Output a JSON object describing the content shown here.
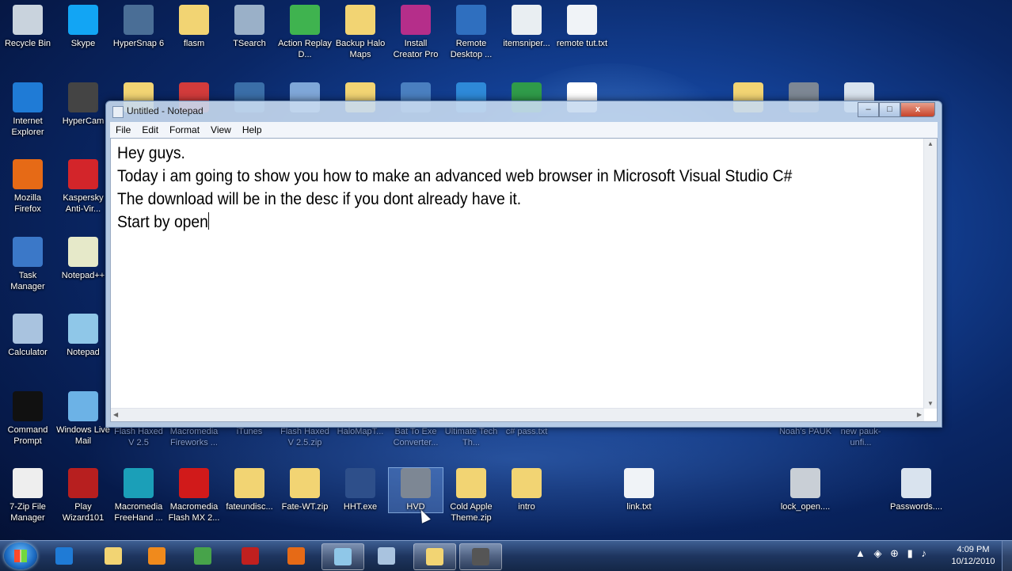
{
  "desktop": {
    "icons": [
      {
        "label": "Recycle Bin",
        "icon": "recycle-bin-icon",
        "color": "#c9d3dd"
      },
      {
        "label": "Skype",
        "icon": "skype-icon",
        "color": "#12a5f4"
      },
      {
        "label": "HyperSnap 6",
        "icon": "hypersnap-icon",
        "color": "#4a6e96"
      },
      {
        "label": "flasm",
        "icon": "folder-icon",
        "color": "#f2d473"
      },
      {
        "label": "TSearch",
        "icon": "tsearch-icon",
        "color": "#9ab0c8"
      },
      {
        "label": "Action Replay D...",
        "icon": "action-replay-icon",
        "color": "#3fb34f"
      },
      {
        "label": "Backup Halo Maps",
        "icon": "folder-icon",
        "color": "#f2d473"
      },
      {
        "label": "Install Creator Pro",
        "icon": "install-creator-icon",
        "color": "#b52e8a"
      },
      {
        "label": "Remote Desktop ...",
        "icon": "remote-desktop-icon",
        "color": "#2f6fbf"
      },
      {
        "label": "itemsniper...",
        "icon": "script-icon",
        "color": "#e9eef2"
      },
      {
        "label": "remote tut.txt",
        "icon": "text-file-icon",
        "color": "#f0f3f7"
      },
      {
        "label": "Internet Explorer",
        "icon": "ie-icon",
        "color": "#1f7bd6"
      },
      {
        "label": "HyperCam",
        "icon": "hypercam-icon",
        "color": "#444444"
      },
      {
        "label": "Mozilla Firefox",
        "icon": "firefox-icon",
        "color": "#e66a16"
      },
      {
        "label": "Kaspersky Anti-Vir...",
        "icon": "kaspersky-icon",
        "color": "#d3252a"
      },
      {
        "label": "Task Manager",
        "icon": "task-manager-icon",
        "color": "#3b78c8"
      },
      {
        "label": "Notepad++",
        "icon": "notepadpp-icon",
        "color": "#e6e9c9"
      },
      {
        "label": "Calculator",
        "icon": "calculator-icon",
        "color": "#a9c3df"
      },
      {
        "label": "Notepad",
        "icon": "notepad-icon",
        "color": "#8fc7e8"
      },
      {
        "label": "Command Prompt",
        "icon": "command-prompt-icon",
        "color": "#111111"
      },
      {
        "label": "Windows Live Mail",
        "icon": "mail-icon",
        "color": "#6cb2e6"
      },
      {
        "label": "7-Zip File Manager",
        "icon": "7zip-icon",
        "color": "#eeeeee"
      },
      {
        "label": "Play Wizard101",
        "icon": "wizard101-icon",
        "color": "#b71f1f"
      },
      {
        "label": "Macromedia FreeHand ...",
        "icon": "freehand-icon",
        "color": "#1b9fb8"
      },
      {
        "label": "Macromedia Flash MX 2...",
        "icon": "flash-icon",
        "color": "#d11a1a"
      },
      {
        "label": "fateundisc...",
        "icon": "zip-folder-icon",
        "color": "#f2d473"
      },
      {
        "label": "Fate-WT.zip",
        "icon": "zip-folder-icon",
        "color": "#f2d473"
      },
      {
        "label": "HHT.exe",
        "icon": "hht-icon",
        "color": "#2e4f8a"
      },
      {
        "label": "HVD",
        "icon": "gears-icon",
        "color": "#7d8794"
      },
      {
        "label": "Cold Apple Theme.zip",
        "icon": "zip-folder-icon",
        "color": "#f2d473"
      },
      {
        "label": "intro",
        "icon": "folder-icon",
        "color": "#f2d473"
      },
      {
        "label": "link.txt",
        "icon": "text-file-icon",
        "color": "#f0f3f7"
      },
      {
        "label": "lock_open....",
        "icon": "lock-icon",
        "color": "#c9cfd6"
      },
      {
        "label": "Passwords....",
        "icon": "settings-file-icon",
        "color": "#d9e3ee"
      }
    ],
    "hidden_labels": [
      "Flash Haxed V 2.5",
      "Macromedia Fireworks ...",
      "iTunes",
      "Flash Haxed V 2.5.zip",
      "HaloMapT...",
      "Bat To Exe Converter...",
      "Ultimate Tech Th...",
      "c# pass.txt",
      "Noah's PAUK",
      "new pauk-unfi..."
    ]
  },
  "notepad": {
    "title": "Untitled - Notepad",
    "menu": [
      "File",
      "Edit",
      "Format",
      "View",
      "Help"
    ],
    "controls": {
      "minimize": "–",
      "maximize": "□",
      "close": "x"
    },
    "text_lines": [
      "Hey guys.",
      "Today i am going to show you how to make an advanced web browser in Microsoft Visual Studio C#",
      "The download will be in the desc if you dont already have it.",
      "Start by open"
    ]
  },
  "taskbar": {
    "start_icon": "windows-start-icon",
    "items": [
      {
        "icon": "ie-icon",
        "color": "#1f7bd6",
        "active": false
      },
      {
        "icon": "explorer-icon",
        "color": "#f2d473",
        "active": false
      },
      {
        "icon": "media-player-icon",
        "color": "#f08a1c",
        "active": false
      },
      {
        "icon": "media-center-icon",
        "color": "#47a34a",
        "active": false
      },
      {
        "icon": "wizard101-icon",
        "color": "#c0201f",
        "active": false
      },
      {
        "icon": "firefox-icon",
        "color": "#e66a16",
        "active": false
      },
      {
        "icon": "notepad-icon",
        "color": "#8fc7e8",
        "active": true
      },
      {
        "icon": "calculator-icon",
        "color": "#a9c3df",
        "active": false
      },
      {
        "icon": "folder-icon",
        "color": "#f2d473",
        "active": true
      },
      {
        "icon": "hypercam-icon",
        "color": "#555555",
        "active": true
      }
    ],
    "tray_icons": [
      "▲",
      "◈",
      "⊕",
      "▮",
      "♪"
    ],
    "time": "4:09 PM",
    "date": "10/12/2010"
  }
}
